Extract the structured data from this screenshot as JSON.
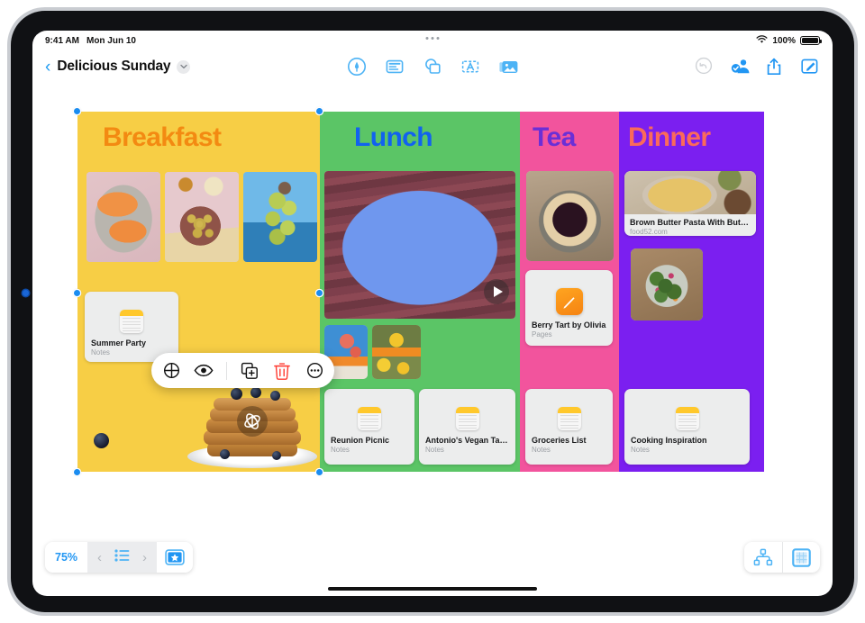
{
  "status_bar": {
    "time": "9:41 AM",
    "date": "Mon Jun 10",
    "wifi_icon": "wifi-icon",
    "battery_percent": "100%",
    "battery_icon": "battery-full-icon",
    "multitask_handle": "multitask-dots-icon"
  },
  "toolbar": {
    "back_icon": "chevron-left-icon",
    "back_label": "‹",
    "document_title": "Delicious Sunday",
    "title_menu_icon": "chevron-down-icon",
    "center_tools": [
      {
        "name": "markup-pen-tool",
        "label": "Markup"
      },
      {
        "name": "note-card-tool",
        "label": "Note"
      },
      {
        "name": "shapes-tool",
        "label": "Shapes"
      },
      {
        "name": "text-box-tool",
        "label": "Text"
      },
      {
        "name": "media-tool",
        "label": "Media"
      }
    ],
    "right_tools": [
      {
        "name": "undo-button",
        "label": "Undo",
        "enabled": false
      },
      {
        "name": "collaborate-button",
        "label": "Collaborate",
        "enabled": true
      },
      {
        "name": "share-button",
        "label": "Share",
        "enabled": true
      },
      {
        "name": "compose-button",
        "label": "Compose",
        "enabled": true
      }
    ]
  },
  "board": {
    "columns": [
      {
        "id": "breakfast",
        "title": "Breakfast",
        "bg_color": "#f7ce45",
        "title_color": "#f38a12",
        "photos": [
          "cantaloupe-slices-photo",
          "figs-on-plate-photo",
          "grapes-over-ocean-photo"
        ],
        "objects": [
          "pancake-stack-object",
          "blueberry-object"
        ],
        "cards": [
          {
            "title": "Summer Party",
            "subtitle": "Notes",
            "app": "notes"
          }
        ]
      },
      {
        "id": "lunch",
        "title": "Lunch",
        "bg_color": "#5bc566",
        "title_color": "#1262ef",
        "video": {
          "name": "tacos-plate-video",
          "has_play_button": true
        },
        "photos": [
          "orange-sculpture-thumb",
          "lemons-flowers-thumb"
        ],
        "cards": [
          {
            "title": "Reunion Picnic",
            "subtitle": "Notes",
            "app": "notes"
          },
          {
            "title": "Antonio's Vegan Tacos",
            "subtitle": "Notes",
            "app": "notes"
          }
        ]
      },
      {
        "id": "tea",
        "title": "Tea",
        "bg_color": "#f2549d",
        "title_color": "#6a2fd6",
        "photos": [
          "berry-galette-photo"
        ],
        "cards": [
          {
            "title": "Berry Tart by Olivia",
            "subtitle": "Pages",
            "app": "pages"
          },
          {
            "title": "Groceries List",
            "subtitle": "Notes",
            "app": "notes"
          }
        ]
      },
      {
        "id": "dinner",
        "title": "Dinner",
        "bg_color": "#7b1ff0",
        "title_color": "#fb6a5a",
        "photos": [
          "green-salad-bowl-photo"
        ],
        "cards": [
          {
            "title": "Brown Butter Pasta With But…",
            "subtitle": "food52.com",
            "app": "link",
            "preview_photo": "pasta-plate-photo"
          },
          {
            "title": "Cooking Inspiration",
            "subtitle": "Notes",
            "app": "notes"
          }
        ]
      }
    ]
  },
  "context_menu": {
    "items": [
      {
        "name": "reposition-icon",
        "label": "Reposition"
      },
      {
        "name": "preview-eye-icon",
        "label": "Preview"
      },
      {
        "name": "duplicate-icon",
        "label": "Duplicate"
      },
      {
        "name": "delete-trash-icon",
        "label": "Delete",
        "color": "#ff3b30"
      },
      {
        "name": "more-options-icon",
        "label": "More"
      }
    ]
  },
  "bottom_bar": {
    "zoom_level": "75%",
    "prev_icon": "chevron-left-icon",
    "prev_label": "‹",
    "page_list_icon": "list-icon",
    "next_icon": "chevron-right-icon",
    "next_label": "›",
    "star_icon": "star-badge-icon",
    "organize_icon": "hierarchy-icon",
    "layout_icon": "grid-layout-icon"
  },
  "accent_colors": {
    "primary_blue": "#2196f3",
    "icon_blue": "#4db3f5",
    "destructive_red": "#ff3b30",
    "notes_yellow": "#ffc82c",
    "pages_orange": "#f58313",
    "selection_blue": "#1a8cf0"
  }
}
